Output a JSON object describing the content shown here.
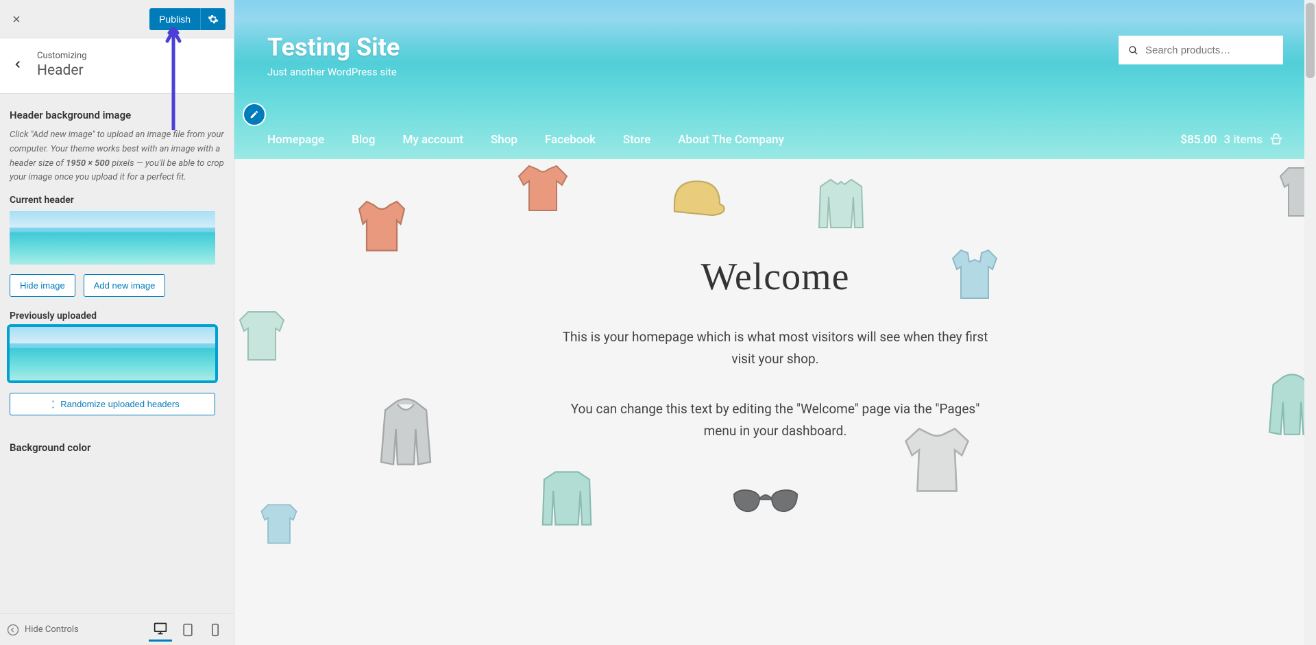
{
  "sidebar": {
    "publish_label": "Publish",
    "customizing_label": "Customizing",
    "section_title": "Header",
    "control_title": "Header background image",
    "control_desc_1": "Click \"Add new image\" to upload an image file from your computer. Your theme works best with an image with a header size of ",
    "control_desc_bold": "1950 × 500",
    "control_desc_2": " pixels — you'll be able to crop your image once you upload it for a perfect fit.",
    "current_header_label": "Current header",
    "hide_image_label": "Hide image",
    "add_new_image_label": "Add new image",
    "previously_uploaded_label": "Previously uploaded",
    "randomize_label": "Randomize uploaded headers",
    "bg_color_label": "Background color",
    "hide_controls_label": "Hide Controls"
  },
  "preview": {
    "site_title": "Testing Site",
    "site_tagline": "Just another WordPress site",
    "search_placeholder": "Search products…",
    "nav": [
      "Homepage",
      "Blog",
      "My account",
      "Shop",
      "Facebook",
      "Store",
      "About The Company"
    ],
    "cart_total": "$85.00",
    "cart_items": "3 items",
    "welcome_title": "Welcome",
    "welcome_p1": "This is your homepage which is what most visitors will see when they first visit your shop.",
    "welcome_p2": "You can change this text by editing the \"Welcome\" page via the \"Pages\" menu in your dashboard."
  }
}
